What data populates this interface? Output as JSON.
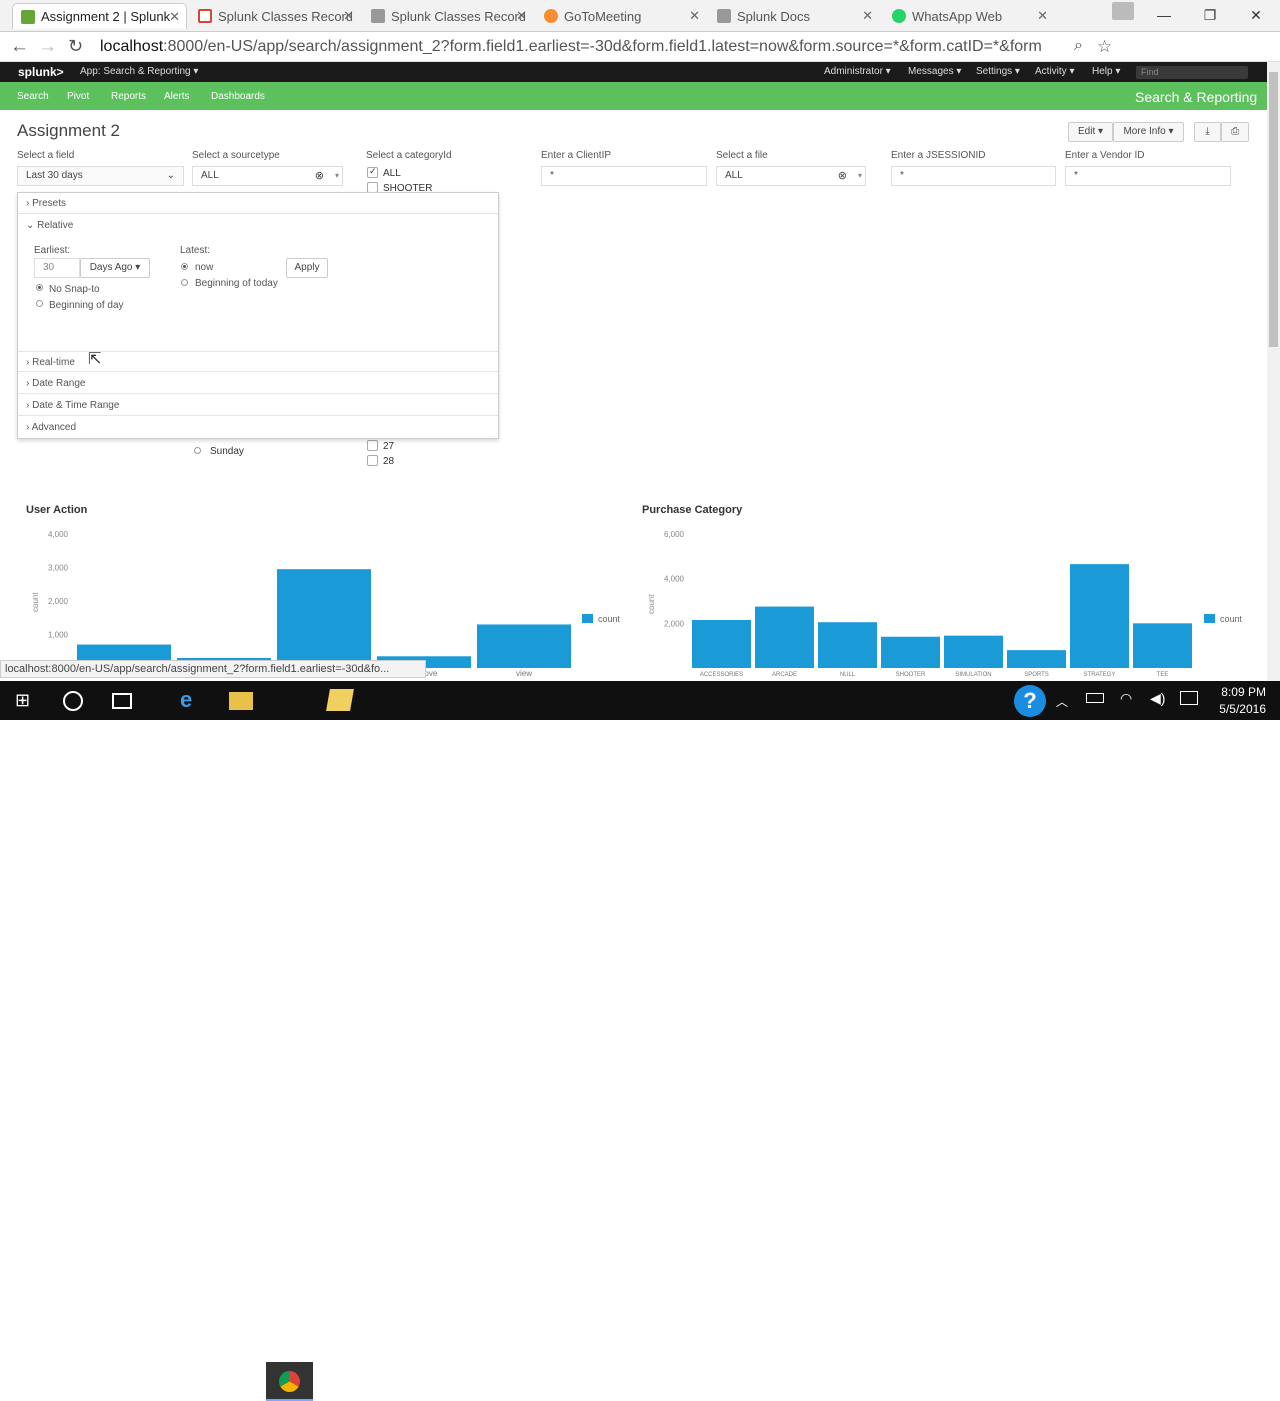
{
  "browser": {
    "tabs": [
      {
        "title": "Assignment 2 | Splunk",
        "color": "#65a637",
        "active": true
      },
      {
        "title": "Splunk Classes Record",
        "color": "#d44638"
      },
      {
        "title": "Splunk Classes Record",
        "color": "#888"
      },
      {
        "title": "GoToMeeting",
        "color": "#f68d2e"
      },
      {
        "title": "Splunk Docs",
        "color": "#888"
      },
      {
        "title": "WhatsApp Web",
        "color": "#25d366"
      }
    ],
    "url_host": "localhost",
    "url_rest": ":8000/en-US/app/search/assignment_2?form.field1.earliest=-30d&form.field1.latest=now&form.source=*&form.catID=*&form"
  },
  "splunk": {
    "logo": "splunk>",
    "app_label": "App: Search & Reporting ▾",
    "top_menu": [
      "Administrator ▾",
      "Messages ▾",
      "Settings ▾",
      "Activity ▾",
      "Help ▾"
    ],
    "find_placeholder": "Find",
    "nav": [
      "Search",
      "Pivot",
      "Reports",
      "Alerts",
      "Dashboards"
    ],
    "app_title": "Search & Reporting"
  },
  "page": {
    "title": "Assignment 2",
    "edit": "Edit ▾",
    "more_info": "More Info ▾",
    "inputs": [
      {
        "label": "Select a field",
        "value": "Last 30 days"
      },
      {
        "label": "Select a sourcetype",
        "value": "ALL"
      },
      {
        "label": "Select a categoryId",
        "value": ""
      },
      {
        "label": "Enter a ClientIP",
        "value": "*"
      },
      {
        "label": "Select a file",
        "value": "ALL"
      },
      {
        "label": "Enter a JSESSIONID",
        "value": "*"
      },
      {
        "label": "Enter a Vendor ID",
        "value": "*"
      }
    ],
    "category_options": [
      "ALL",
      "SHOOTER"
    ],
    "category_options_lower": [
      "27",
      "28"
    ],
    "lower_radio": "Sunday"
  },
  "timepicker": {
    "presets": "Presets",
    "relative": "Relative",
    "earliest_label": "Earliest:",
    "earliest_value": "30",
    "unit": "Days Ago ▾",
    "latest_label": "Latest:",
    "latest_now": "now",
    "latest_bod": "Beginning of today",
    "snap_none": "No Snap-to",
    "snap_bod": "Beginning of day",
    "apply": "Apply",
    "sections": [
      "Real-time",
      "Date Range",
      "Date & Time Range",
      "Advanced"
    ]
  },
  "chart_data": [
    {
      "type": "bar",
      "title": "User Action",
      "ylabel": "count",
      "legend": "count",
      "yticks": [
        "4,000",
        "3,000",
        "2,000",
        "1,000"
      ],
      "categories": [
        "",
        "",
        "",
        "remove",
        "view"
      ],
      "values": [
        700,
        300,
        2950,
        350,
        1300
      ],
      "ylim": [
        0,
        4000
      ]
    },
    {
      "type": "bar",
      "title": "Purchase Category",
      "ylabel": "count",
      "legend": "count",
      "yticks": [
        "6,000",
        "4,000",
        "2,000"
      ],
      "categories": [
        "ACCESSORIES",
        "ARCADE",
        "NULL",
        "SHOOTER",
        "SIMULATION",
        "SPORTS",
        "STRATEGY",
        "TEE"
      ],
      "values": [
        2150,
        2750,
        2050,
        1400,
        1450,
        800,
        4650,
        2000
      ],
      "ylim": [
        0,
        6000
      ]
    }
  ],
  "status": "localhost:8000/en-US/app/search/assignment_2?form.field1.earliest=-30d&fo...",
  "clock": {
    "time": "8:09 PM",
    "date": "5/5/2016"
  }
}
